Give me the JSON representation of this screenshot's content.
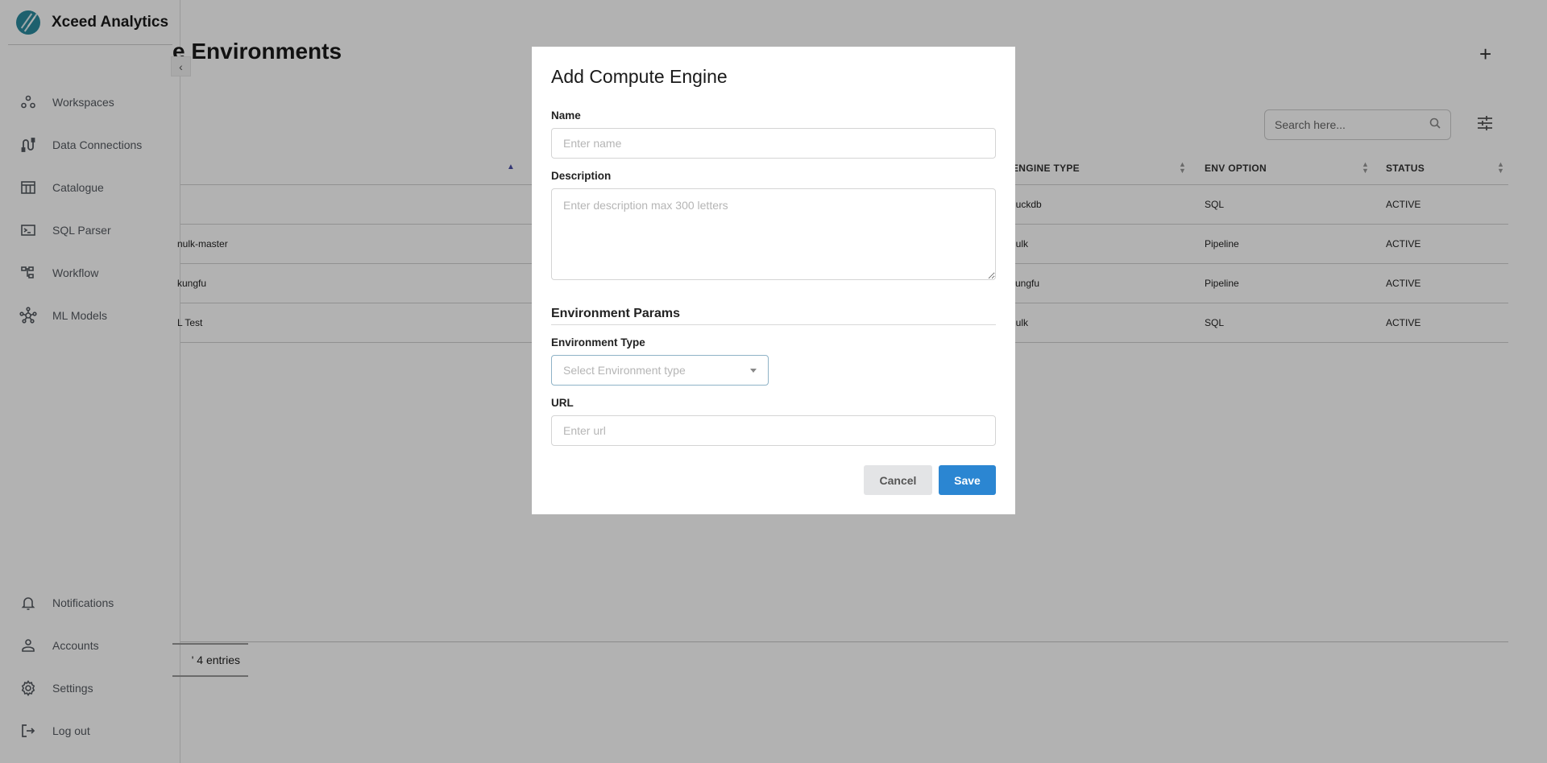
{
  "app": {
    "brand_name": "Xceed Analytics"
  },
  "sidebar": {
    "top_items": [
      {
        "label": "Workspaces",
        "icon": "workspaces-icon"
      },
      {
        "label": "Data Connections",
        "icon": "data-connections-icon"
      },
      {
        "label": "Catalogue",
        "icon": "catalogue-icon"
      },
      {
        "label": "SQL Parser",
        "icon": "terminal-icon"
      },
      {
        "label": "Workflow",
        "icon": "workflow-icon"
      },
      {
        "label": "ML Models",
        "icon": "ml-models-icon"
      }
    ],
    "bottom_items": [
      {
        "label": "Notifications",
        "icon": "bell-icon"
      },
      {
        "label": "Accounts",
        "icon": "user-icon"
      },
      {
        "label": "Settings",
        "icon": "gear-icon"
      },
      {
        "label": "Log out",
        "icon": "logout-icon"
      }
    ]
  },
  "page": {
    "title": "e Environments",
    "search_placeholder": "Search here...",
    "entries_text": "' 4 entries"
  },
  "table": {
    "headers": [
      "ENGINE TYPE",
      "ENV OPTION",
      "STATUS"
    ],
    "rows": [
      {
        "name": "",
        "engine_type": "duckdb",
        "env_option": "SQL",
        "status": "ACTIVE"
      },
      {
        "name": "nulk-master",
        "engine_type": "nulk",
        "env_option": "Pipeline",
        "status": "ACTIVE"
      },
      {
        "name": "kungfu",
        "engine_type": "kungfu",
        "env_option": "Pipeline",
        "status": "ACTIVE"
      },
      {
        "name": "L Test",
        "engine_type": "nulk",
        "env_option": "SQL",
        "status": "ACTIVE"
      }
    ]
  },
  "modal": {
    "title": "Add Compute Engine",
    "name_label": "Name",
    "name_placeholder": "Enter name",
    "name_value": "",
    "description_label": "Description",
    "description_placeholder": "Enter description max 300 letters",
    "description_value": "",
    "section_title": "Environment Params",
    "env_type_label": "Environment Type",
    "env_type_placeholder": "Select Environment type",
    "url_label": "URL",
    "url_placeholder": "Enter url",
    "url_value": "",
    "cancel_label": "Cancel",
    "save_label": "Save"
  },
  "colors": {
    "accent": "#2b86d2",
    "brand": "#2a8a9e",
    "sort_active": "#4b50a8",
    "overlay": "rgba(0,0,0,0.3)"
  }
}
